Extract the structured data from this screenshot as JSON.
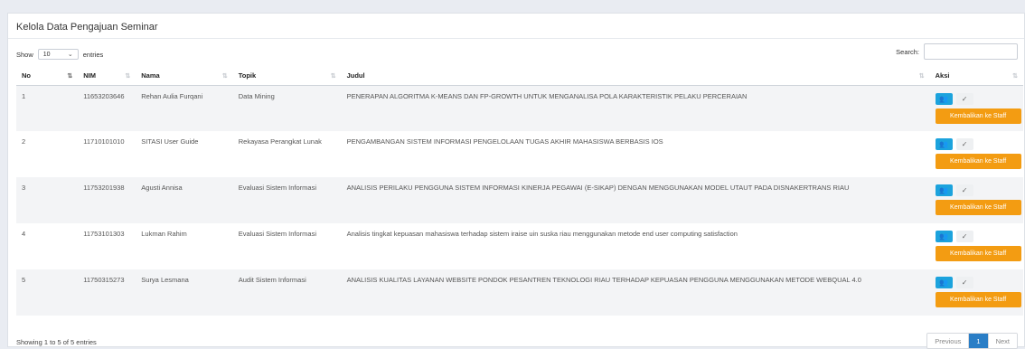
{
  "card": {
    "title": "Kelola Data Pengajuan Seminar"
  },
  "length_menu": {
    "show_label": "Show",
    "value": "10",
    "entries_label": "entries"
  },
  "search": {
    "label": "Search:",
    "value": ""
  },
  "table": {
    "columns": [
      "No",
      "NIM",
      "Nama",
      "Topik",
      "Judul",
      "Aksi"
    ],
    "rows": [
      {
        "no": "1",
        "nim": "11653203646",
        "nama": "Rehan Aulia Furqani",
        "topik": "Data Mining",
        "judul": "PENERAPAN ALGORITMA K-MEANS DAN FP-GROWTH UNTUK MENGANALISA POLA KARAKTERISTIK PELAKU PERCERAIAN"
      },
      {
        "no": "2",
        "nim": "11710101010",
        "nama": "SITASI User Guide",
        "topik": "Rekayasa Perangkat Lunak",
        "judul": "PENGAMBANGAN SISTEM INFORMASI PENGELOLAAN TUGAS AKHIR MAHASISWA BERBASIS IOS"
      },
      {
        "no": "3",
        "nim": "11753201938",
        "nama": "Agusti Annisa",
        "topik": "Evaluasi Sistem Informasi",
        "judul": "ANALISIS PERILAKU PENGGUNA SISTEM INFORMASI KINERJA PEGAWAI (E-SIKAP) DENGAN MENGGUNAKAN MODEL UTAUT PADA DISNAKERTRANS RIAU"
      },
      {
        "no": "4",
        "nim": "11753101303",
        "nama": "Lukman Rahim",
        "topik": "Evaluasi Sistem Informasi",
        "judul": "Analisis tingkat kepuasan mahasiswa terhadap sistem iraise uin suska riau menggunakan metode end user computing satisfaction"
      },
      {
        "no": "5",
        "nim": "11750315273",
        "nama": "Surya Lesmana",
        "topik": "Audit Sistem Informasi",
        "judul": "ANALISIS KUALITAS LAYANAN WEBSITE PONDOK PESANTREN TEKNOLOGI RIAU TERHADAP KEPUASAN PENGGUNA MENGGUNAKAN METODE WEBQUAL 4.0"
      }
    ],
    "action_label": "Kembalikan ke Staff"
  },
  "footer": {
    "info": "Showing 1 to 5 of 5 entries"
  },
  "pagination": {
    "previous": "Previous",
    "current": "1",
    "next": "Next"
  },
  "colors": {
    "info_button": "#1ca3dd",
    "warning_button": "#f39c12",
    "active_page": "#2a7ec6"
  },
  "icons": {
    "user_button": "users-icon",
    "check_button": "check-icon",
    "sort": "sort-icon"
  }
}
